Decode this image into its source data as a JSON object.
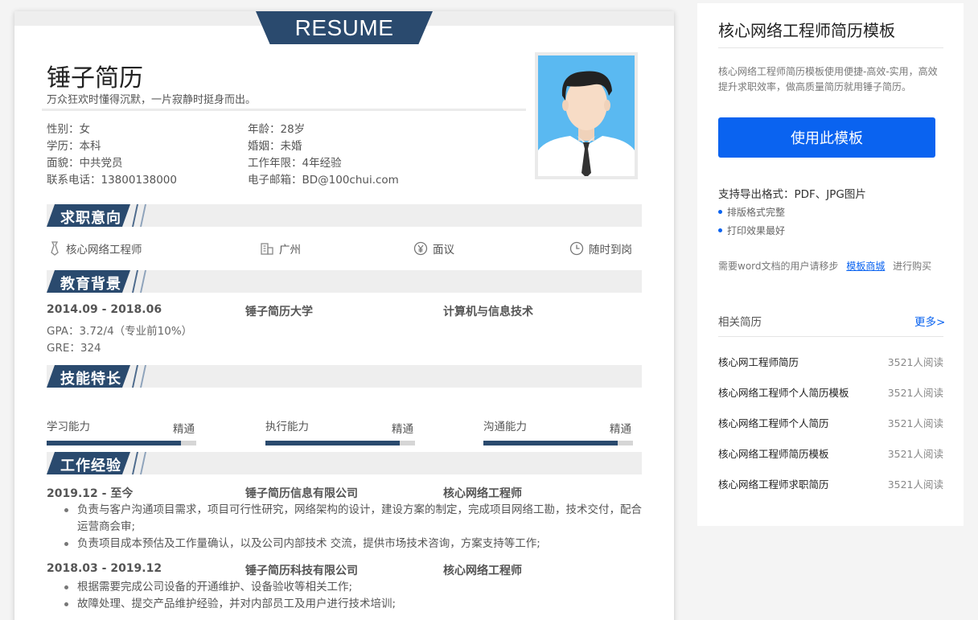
{
  "resume": {
    "banner": "RESUME",
    "name": "锤子简历",
    "motto": "万众狂欢时懂得沉默，一片寂静时挺身而出。",
    "info": [
      "性别：女",
      "年龄：28岁",
      "学历：本科",
      "婚姻：未婚",
      "面貌：中共党员",
      "工作年限：4年经验",
      "联系电话：13800138000",
      "电子邮箱：BD@100chui.com"
    ],
    "sections": {
      "intent": "求职意向",
      "education": "教育背景",
      "skills": "技能特长",
      "work": "工作经验"
    },
    "intent": {
      "position": "核心网络工程师",
      "city": "广州",
      "salary": "面议",
      "availability": "随时到岗"
    },
    "education": {
      "period": "2014.09 - 2018.06",
      "school": "锤子简历大学",
      "major": "计算机与信息技术",
      "gpa": "GPA：3.72/4（专业前10%）",
      "gre": "GRE：324"
    },
    "skills": [
      {
        "name": "学习能力",
        "level": "精通",
        "fraction": 0.9
      },
      {
        "name": "执行能力",
        "level": "精通",
        "fraction": 0.9
      },
      {
        "name": "沟通能力",
        "level": "精通",
        "fraction": 0.9
      }
    ],
    "work": [
      {
        "period": "2019.12 - 至今",
        "company": "锤子简历信息有限公司",
        "title": "核心网络工程师",
        "bullets": [
          "负责与客户沟通项目需求，项目可行性研究，网络架构的设计，建设方案的制定，完成项目网络工勘，技术交付，配合运营商会审;",
          "负责项目成本预估及工作量确认，以及公司内部技术 交流，提供市场技术咨询，方案支持等工作;"
        ]
      },
      {
        "period": "2018.03 - 2019.12",
        "company": "锤子简历科技有限公司",
        "title": "核心网络工程师",
        "bullets": [
          "根据需要完成公司设备的开通维护、设备验收等相关工作;",
          "故障处理、提交产品维护经验，并对内部员工及用户进行技术培训;"
        ]
      }
    ]
  },
  "side": {
    "title": "核心网络工程师简历模板",
    "description": "核心网络工程师简历模板使用便捷-高效-实用，高效提升求职效率，做高质量简历就用锤子简历。",
    "use_button": "使用此模板",
    "export_formats": "支持导出格式：PDF、JPG图片",
    "features": [
      "排版格式完整",
      "打印效果最好"
    ],
    "word_note_prefix": "需要word文档的用户请移步",
    "word_note_link": "模板商城",
    "word_note_suffix": "进行购买",
    "related_title": "相关简历",
    "more": "更多>",
    "related": [
      {
        "title": "核心网工程师简历",
        "reads": "3521人阅读"
      },
      {
        "title": "核心网络工程师个人简历模板",
        "reads": "3521人阅读"
      },
      {
        "title": "核心网络工程师个人简历",
        "reads": "3521人阅读"
      },
      {
        "title": "核心网络工程师简历模板",
        "reads": "3521人阅读"
      },
      {
        "title": "核心网络工程师求职简历",
        "reads": "3521人阅读"
      }
    ]
  },
  "colors": {
    "accent_navy": "#2a4a6e",
    "button_blue": "#0a63f0",
    "photo_bg": "#5ab9f1"
  }
}
